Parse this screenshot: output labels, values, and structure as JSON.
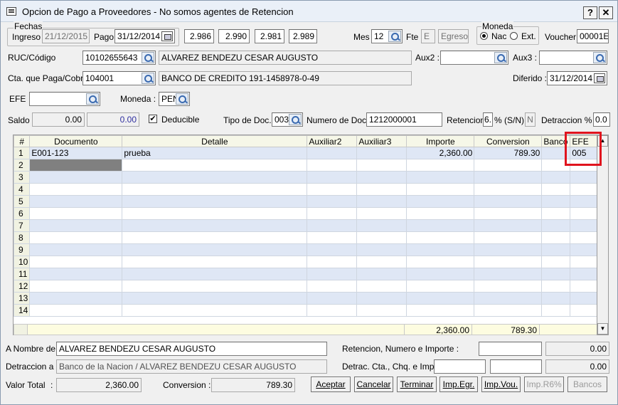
{
  "window": {
    "title": "Opcion de Pago a Proveedores - No somos agentes de Retencion",
    "help_label": "?",
    "close_label": "✕"
  },
  "fechas": {
    "group_label": "Fechas",
    "ingreso_label": "Ingreso",
    "ingreso_value": "21/12/2015",
    "pago_label": "Pago",
    "pago_value": "31/12/2014"
  },
  "rates": [
    "2.986",
    "2.990",
    "2.981",
    "2.989"
  ],
  "mes": {
    "label": "Mes",
    "value": "12"
  },
  "fte": {
    "label": "Fte",
    "value": "E",
    "tipo": "Egreso"
  },
  "moneda": {
    "group_label": "Moneda",
    "nac_label": "Nac",
    "ext_label": "Ext.",
    "selected": "Nac"
  },
  "voucher": {
    "label": "Voucher",
    "value": "00001E"
  },
  "ruc": {
    "label": "RUC/Código",
    "value": "10102655643",
    "name": "ALVAREZ BENDEZU CESAR AUGUSTO"
  },
  "aux2": {
    "label": "Aux2 :",
    "value": ""
  },
  "aux3": {
    "label": "Aux3 :",
    "value": ""
  },
  "cta": {
    "label": "Cta. que Paga/Cobra",
    "value": "104001",
    "name": "BANCO DE CREDITO 191-1458978-0-49"
  },
  "diferido": {
    "label": "Diferido :",
    "value": "31/12/2014"
  },
  "efe": {
    "label": "EFE",
    "value": ""
  },
  "moneda2": {
    "label": "Moneda :",
    "value": "PEN"
  },
  "saldo": {
    "label": "Saldo",
    "value1": "0.00",
    "value2": "0.00"
  },
  "deducible": {
    "label": "Deducible",
    "checked": "✔"
  },
  "tipo_doc": {
    "label": "Tipo de Doc.",
    "value": "003"
  },
  "num_doc": {
    "label": "Numero de Doc.",
    "value": "1212000001"
  },
  "retencion": {
    "label": "Retencion",
    "value": "6.",
    "sn_label": "% (S/N)",
    "sn_value": "N"
  },
  "detraccion": {
    "label": "Detraccion %",
    "value": "0.0"
  },
  "grid": {
    "columns": [
      "#",
      "Documento",
      "Detalle",
      "Auxiliar2",
      "Auxiliar3",
      "Importe",
      "Conversion",
      "Banco",
      "EFE"
    ],
    "rows": [
      {
        "n": "1",
        "documento": "E001-123",
        "detalle": "prueba",
        "aux2": "",
        "aux3": "",
        "importe": "2,360.00",
        "conversion": "789.30",
        "banco": "",
        "efe": "005"
      },
      {
        "n": "2"
      },
      {
        "n": "3"
      },
      {
        "n": "4"
      },
      {
        "n": "5"
      },
      {
        "n": "6"
      },
      {
        "n": "7"
      },
      {
        "n": "8"
      },
      {
        "n": "9"
      },
      {
        "n": "10"
      },
      {
        "n": "11"
      },
      {
        "n": "12"
      },
      {
        "n": "13"
      },
      {
        "n": "14"
      }
    ],
    "total_importe": "2,360.00",
    "total_conversion": "789.30"
  },
  "a_nombre": {
    "label": "A Nombre de :",
    "value": "ALVAREZ BENDEZU CESAR AUGUSTO"
  },
  "ret_num": {
    "label": "Retencion, Numero e Importe :",
    "value1": "",
    "value2": "0.00"
  },
  "detraccion_a": {
    "label": "Detraccion a :",
    "value": "Banco de la Nacion / ALVAREZ BENDEZU CESAR AUGUSTO"
  },
  "detrac_cta": {
    "label": "Detrac. Cta., Chq. e Imp. :",
    "value1": "",
    "value2": "",
    "value3": "0.00"
  },
  "valor_total": {
    "label": "Valor Total",
    "sep": ":",
    "value": "2,360.00"
  },
  "conversion": {
    "label": "Conversion :",
    "value": "789.30"
  },
  "buttons": {
    "aceptar": "Aceptar",
    "cancelar": "Cancelar",
    "terminar": "Terminar",
    "imp_egr": "Imp.Egr.",
    "imp_vou": "Imp.Vou.",
    "imp_r6": "Imp.R6%",
    "bancos": "Bancos"
  },
  "colors": {
    "highlight": "#e0141e",
    "row_alt": "#dfe7f5",
    "header": "#f6f7e8"
  }
}
